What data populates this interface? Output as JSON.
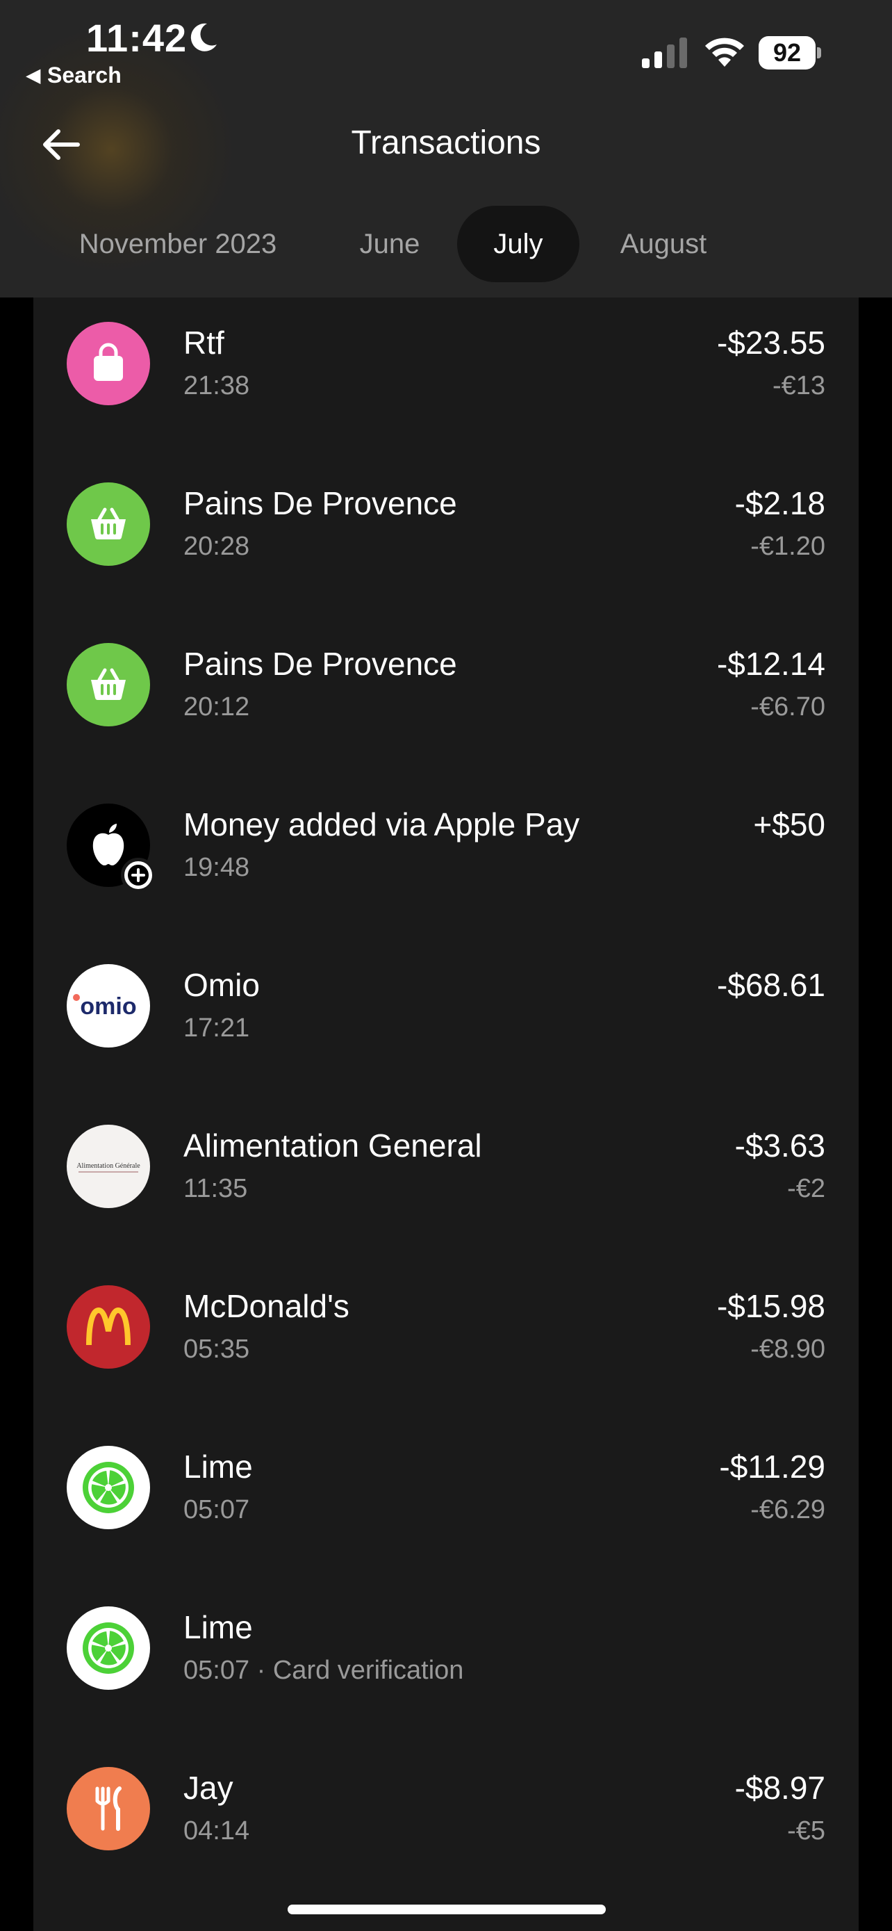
{
  "status_bar": {
    "time": "11:42",
    "back_label": "Search",
    "battery": "92"
  },
  "header": {
    "title": "Transactions",
    "tabs": [
      {
        "label": "November 2023"
      },
      {
        "label": "June"
      },
      {
        "label": "July",
        "active": true
      },
      {
        "label": "August"
      }
    ]
  },
  "transactions": [
    {
      "name": "Rtf",
      "time": "21:38",
      "amount": "-$23.55",
      "amount_local": "-€13",
      "icon": "shopping-bag-icon",
      "color": "#ec5ca8"
    },
    {
      "name": "Pains De Provence",
      "time": "20:28",
      "amount": "-$2.18",
      "amount_local": "-€1.20",
      "icon": "basket-icon",
      "color": "#6fc84a"
    },
    {
      "name": "Pains De Provence",
      "time": "20:12",
      "amount": "-$12.14",
      "amount_local": "-€6.70",
      "icon": "basket-icon",
      "color": "#6fc84a"
    },
    {
      "name": "Money added via Apple Pay",
      "time": "19:48",
      "amount": "+$50",
      "amount_local": "",
      "icon": "apple-icon",
      "color": "#000000"
    },
    {
      "name": "Omio",
      "time": "17:21",
      "amount": "-$68.61",
      "amount_local": "",
      "icon": "omio-logo",
      "color": "#ffffff",
      "logo_text": "omio"
    },
    {
      "name": "Alimentation General",
      "time": "11:35",
      "amount": "-$3.63",
      "amount_local": "-€2",
      "icon": "alimentation-logo",
      "color": "#f4f2f0",
      "logo_text": "Alimentation Générale"
    },
    {
      "name": "McDonald's",
      "time": "05:35",
      "amount": "-$15.98",
      "amount_local": "-€8.90",
      "icon": "mcdonalds-logo",
      "color": "#c1272d"
    },
    {
      "name": "Lime",
      "time": "05:07",
      "amount": "-$11.29",
      "amount_local": "-€6.29",
      "icon": "lime-logo",
      "color": "#ffffff"
    },
    {
      "name": "Lime",
      "time": "05:07 · Card verification",
      "amount": "",
      "amount_local": "",
      "icon": "lime-logo",
      "color": "#ffffff"
    },
    {
      "name": "Jay",
      "time": "04:14",
      "amount": "-$8.97",
      "amount_local": "-€5",
      "icon": "fork-knife-icon",
      "color": "#f07d4f"
    }
  ]
}
